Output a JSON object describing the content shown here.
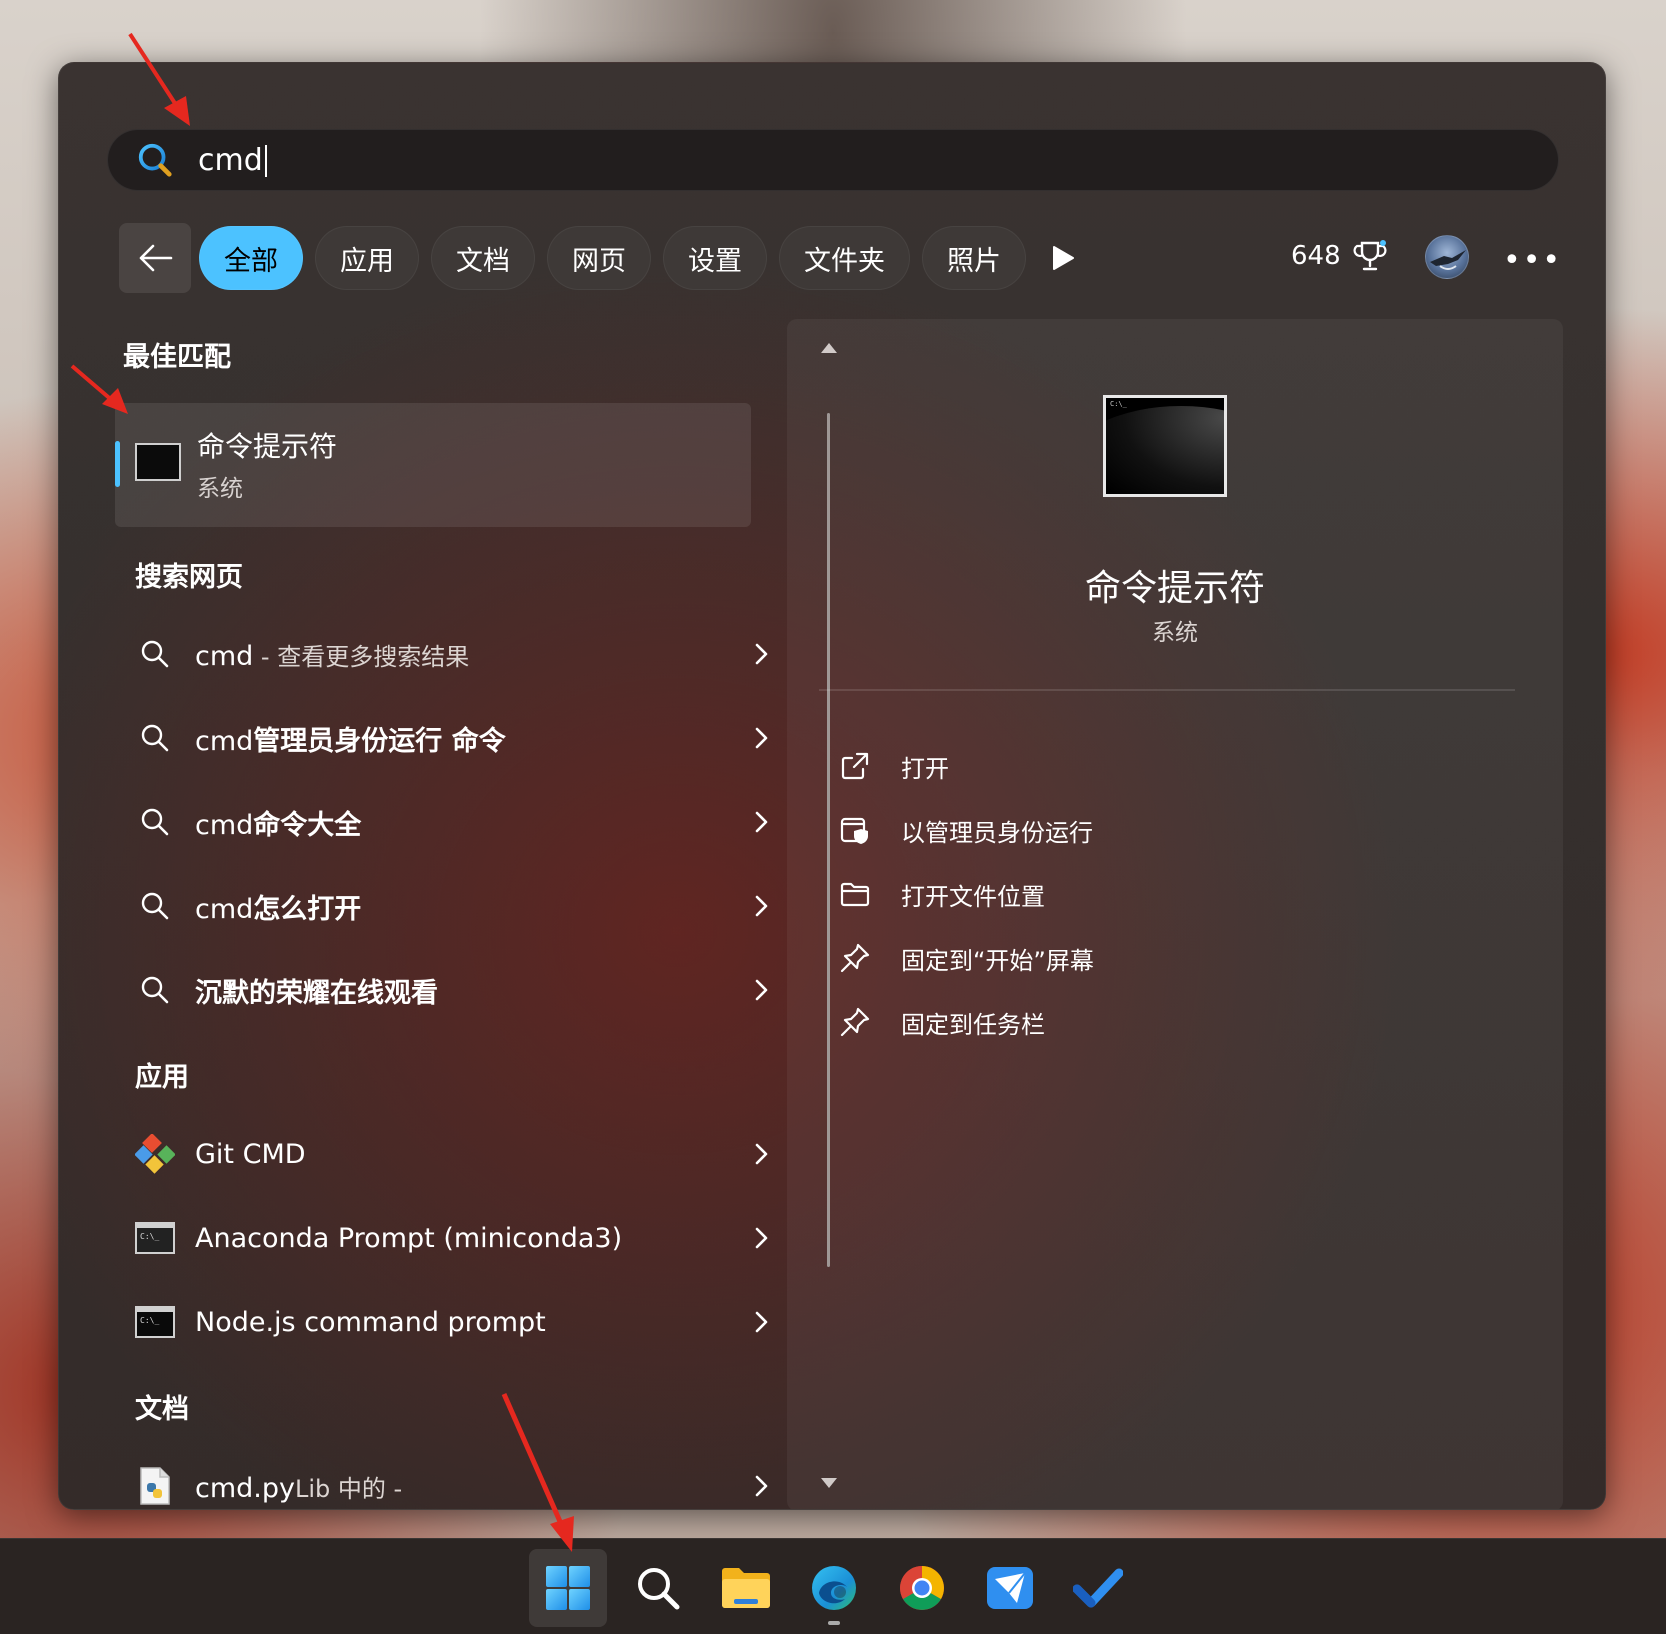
{
  "search": {
    "query": "cmd"
  },
  "filters": {
    "tabs": [
      "全部",
      "应用",
      "文档",
      "网页",
      "设置",
      "文件夹",
      "照片"
    ],
    "active_index": 0,
    "points": "648"
  },
  "best_match": {
    "heading": "最佳匹配",
    "title": "命令提示符",
    "subtitle": "系统"
  },
  "web": {
    "heading": "搜索网页",
    "items": [
      {
        "prefix": "cmd",
        "suffix": " - 查看更多搜索结果"
      },
      {
        "prefix": "cmd",
        "bold": "管理员身份运行 命令"
      },
      {
        "prefix": "cmd",
        "bold": "命令大全"
      },
      {
        "prefix": "cmd",
        "bold": "怎么打开"
      },
      {
        "prefix": "",
        "bold": "沉默的荣耀在线观看"
      }
    ]
  },
  "apps": {
    "heading": "应用",
    "items": [
      {
        "label": "Git CMD",
        "icon": "git-icon"
      },
      {
        "label": "Anaconda Prompt (miniconda3)",
        "icon": "terminal-icon"
      },
      {
        "label": "Node.js command prompt",
        "icon": "terminal-icon"
      }
    ]
  },
  "docs": {
    "heading": "文档",
    "items": [
      {
        "label": "cmd.py",
        "suffix": "Lib 中的 -"
      }
    ]
  },
  "detail": {
    "title": "命令提示符",
    "subtitle": "系统",
    "actions": [
      {
        "label": "打开",
        "icon": "open-external-icon"
      },
      {
        "label": "以管理员身份运行",
        "icon": "shield-icon"
      },
      {
        "label": "打开文件位置",
        "icon": "folder-icon"
      },
      {
        "label": "固定到“开始”屏幕",
        "icon": "pin-icon"
      },
      {
        "label": "固定到任务栏",
        "icon": "pin-icon"
      }
    ]
  },
  "colors": {
    "accent": "#4cc2ff",
    "annotation": "#e5281f"
  }
}
